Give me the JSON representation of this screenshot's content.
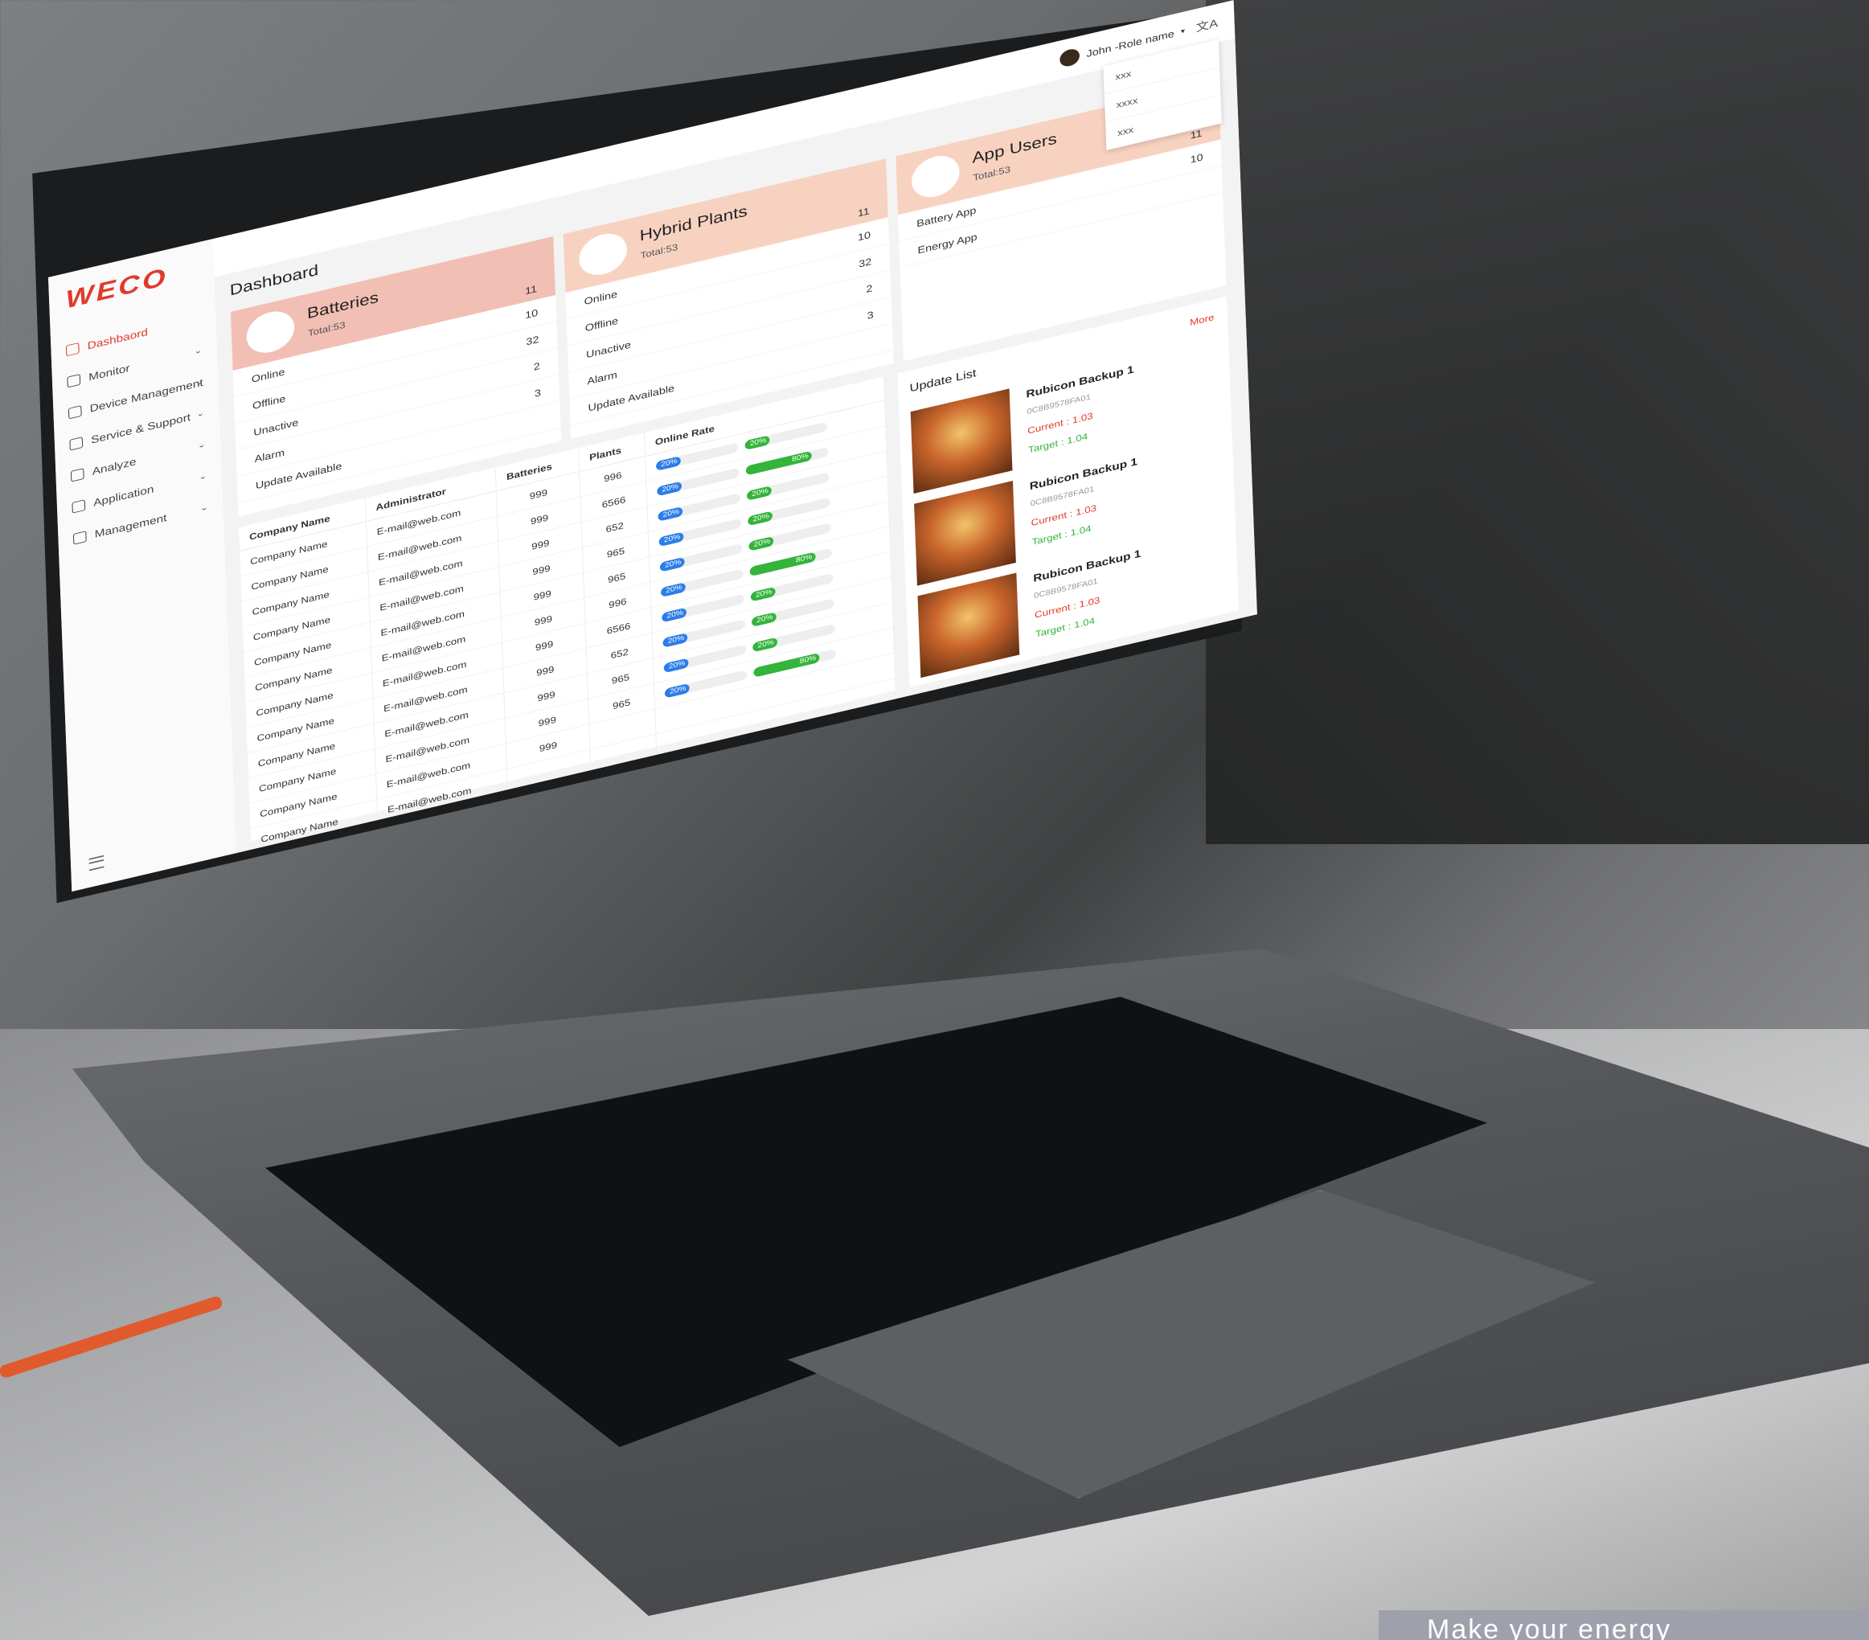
{
  "app": {
    "logo": "WECO",
    "tagline": "Make your energy"
  },
  "header": {
    "user_label": "John -Role name",
    "caret": "▾",
    "lang_icon": "文A",
    "dropdown": [
      "xxx",
      "xxxx",
      "xxx"
    ]
  },
  "sidebar": {
    "items": [
      {
        "label": "Dashbaord",
        "icon": "dashboard-icon",
        "active": true
      },
      {
        "label": "Monitor",
        "icon": "edit-icon"
      },
      {
        "label": "Device Management",
        "icon": "grid-icon"
      },
      {
        "label": "Service & Support",
        "icon": "document-icon"
      },
      {
        "label": "Analyze",
        "icon": "check-circle-icon"
      },
      {
        "label": "Application",
        "icon": "warning-icon"
      },
      {
        "label": "Management",
        "icon": "user-icon"
      }
    ],
    "chevron": "⌄"
  },
  "main": {
    "title": "Dashboard",
    "cards": [
      {
        "title": "Batteries",
        "total": "Total:53",
        "head_value": "11",
        "color": "#f2bfb5",
        "rows": [
          {
            "label": "Online",
            "value": "10"
          },
          {
            "label": "Offline",
            "value": "32"
          },
          {
            "label": "Unactive",
            "value": "2"
          },
          {
            "label": "Alarm",
            "value": "3"
          },
          {
            "label": "Update Available",
            "value": ""
          }
        ]
      },
      {
        "title": "Hybrid Plants",
        "total": "Total:53",
        "head_value": "11",
        "color": "#f8d2c0",
        "rows": [
          {
            "label": "Online",
            "value": "10"
          },
          {
            "label": "Offline",
            "value": "32"
          },
          {
            "label": "Unactive",
            "value": "2"
          },
          {
            "label": "Alarm",
            "value": "3"
          },
          {
            "label": "Update Available",
            "value": ""
          }
        ]
      },
      {
        "title": "App Users",
        "total": "Total:53",
        "head_value": "11",
        "color": "#f8d2c0",
        "rows": [
          {
            "label": "Battery App",
            "value": "10"
          },
          {
            "label": "Energy App",
            "value": ""
          }
        ]
      }
    ],
    "table": {
      "headers": [
        "Company Name",
        "Administrator",
        "Batteries",
        "Plants",
        "Online Rate"
      ],
      "rows": [
        {
          "company": "Company Name",
          "admin": "E-mail@web.com",
          "batteries": "999",
          "plants": "996",
          "rate_a": "20%",
          "rate_b": "20%"
        },
        {
          "company": "Company Name",
          "admin": "E-mail@web.com",
          "batteries": "999",
          "plants": "6566",
          "rate_a": "20%",
          "rate_b": "80%"
        },
        {
          "company": "Company Name",
          "admin": "E-mail@web.com",
          "batteries": "999",
          "plants": "652",
          "rate_a": "20%",
          "rate_b": "20%"
        },
        {
          "company": "Company Name",
          "admin": "E-mail@web.com",
          "batteries": "999",
          "plants": "965",
          "rate_a": "20%",
          "rate_b": "20%"
        },
        {
          "company": "Company Name",
          "admin": "E-mail@web.com",
          "batteries": "999",
          "plants": "965",
          "rate_a": "20%",
          "rate_b": "20%"
        },
        {
          "company": "Company Name",
          "admin": "E-mail@web.com",
          "batteries": "999",
          "plants": "996",
          "rate_a": "20%",
          "rate_b": "80%"
        },
        {
          "company": "Company Name",
          "admin": "E-mail@web.com",
          "batteries": "999",
          "plants": "6566",
          "rate_a": "20%",
          "rate_b": "20%"
        },
        {
          "company": "Company Name",
          "admin": "E-mail@web.com",
          "batteries": "999",
          "plants": "652",
          "rate_a": "20%",
          "rate_b": "20%"
        },
        {
          "company": "Company Name",
          "admin": "E-mail@web.com",
          "batteries": "999",
          "plants": "965",
          "rate_a": "20%",
          "rate_b": "20%"
        },
        {
          "company": "Company Name",
          "admin": "E-mail@web.com",
          "batteries": "999",
          "plants": "965",
          "rate_a": "20%",
          "rate_b": "80%"
        },
        {
          "company": "Company Name",
          "admin": "E-mail@web.com",
          "batteries": "999",
          "plants": "",
          "rate_a": "",
          "rate_b": ""
        },
        {
          "company": "Company Name",
          "admin": "E-mail@web.com",
          "batteries": "",
          "plants": "",
          "rate_a": "",
          "rate_b": ""
        }
      ]
    },
    "updates": {
      "title": "Update List",
      "more": "More",
      "items": [
        {
          "name": "Rubicon Backup 1",
          "code": "0C8B9578FA01",
          "current": "Current : 1.03",
          "target": "Target : 1.04"
        },
        {
          "name": "Rubicon Backup 1",
          "code": "0C8B9578FA01",
          "current": "Current : 1.03",
          "target": "Target : 1.04"
        },
        {
          "name": "Rubicon Backup 1",
          "code": "0C8B9578FA01",
          "current": "Current : 1.03",
          "target": "Target : 1.04"
        }
      ]
    }
  }
}
